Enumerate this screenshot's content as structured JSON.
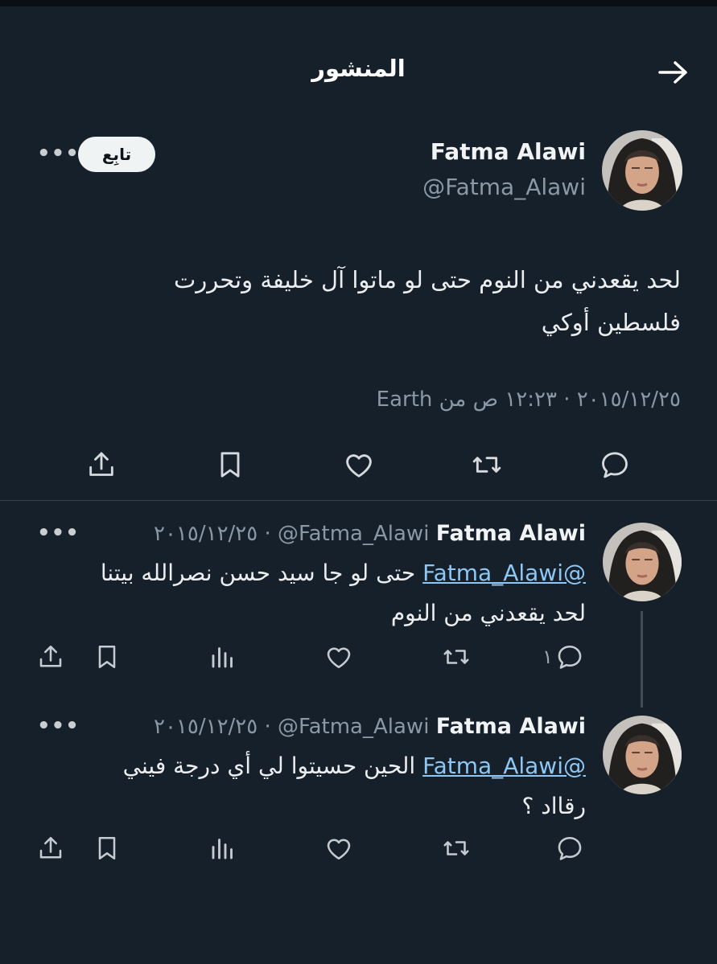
{
  "header": {
    "title": "المنشور",
    "back_icon": "arrow-right-icon"
  },
  "tweet": {
    "author_name": "Fatma Alawi",
    "author_handle": "@Fatma_Alawi",
    "follow_label": "تابِع",
    "more_label": "•••",
    "text_line1": "لحد يقعدني من النوم حتى لو ماتوا آل خليفة وتحررت",
    "text_line2": "فلسطين أوكي",
    "meta": "٢٠١٥/١٢/٢٥ · ١٢:٢٣ ص من Earth",
    "action_icons": [
      "reply-icon",
      "retweet-icon",
      "like-icon",
      "bookmark-icon",
      "share-icon"
    ]
  },
  "replies": [
    {
      "author_name": "Fatma Alawi",
      "author_handle": "@Fatma_Alawi",
      "date": "٢٠١٥/١٢/٢٥",
      "mention": "@Fatma_Alawi",
      "text_line1": "حتى لو جا سيد حسن نصرالله بيتنا",
      "text_line2": "لحد يقعدني من النوم",
      "reply_count": "١",
      "more_label": "•••"
    },
    {
      "author_name": "Fatma Alawi",
      "author_handle": "@Fatma_Alawi",
      "date": "٢٠١٥/١٢/٢٥",
      "mention": "@Fatma_Alawi",
      "text_line1": "الحين حسيتوا لي أي درجة فيني",
      "text_line2": "رقااد ؟",
      "more_label": "•••"
    }
  ],
  "colors": {
    "background": "#15202b",
    "link": "#8fc7f4",
    "muted": "#8b98a5",
    "divider": "#38444d"
  }
}
